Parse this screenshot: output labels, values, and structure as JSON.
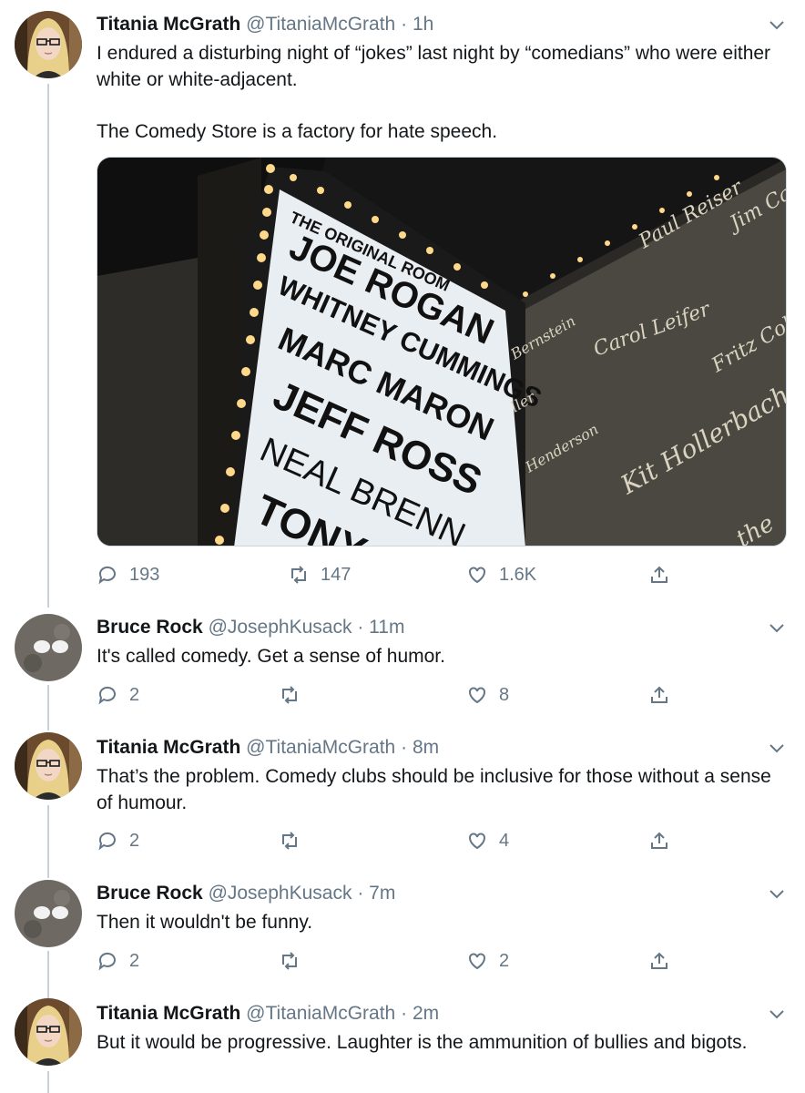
{
  "tweets": [
    {
      "name": "Titania McGrath",
      "handle": "@TitaniaMcGrath",
      "time": "1h",
      "text_1": "I endured a disturbing night of “jokes” last night by “comedians” who were either white or white-adjacent.",
      "text_2": "The Comedy Store is a factory for hate speech.",
      "replies": "193",
      "retweets": "147",
      "likes": "1.6K",
      "avatar_icon": "woman-portrait-avatar",
      "marquee": {
        "header": "THE ORIGINAL ROOM",
        "lines": [
          "JOE ROGAN",
          "WHITNEY CUMMINGS",
          "MARC MARON",
          "JEFF ROSS",
          "NEAL BRENN",
          "TONY"
        ],
        "wall_signatures": [
          "Paul Reiser",
          "Jim Ca",
          "Carol Leifer",
          "Fritz Col",
          "Kit Hollerbach",
          "the",
          "Bernstein",
          "Henderson",
          "ller"
        ]
      }
    },
    {
      "name": "Bruce Rock",
      "handle": "@JosephKusack",
      "time": "11m",
      "text_1": "It's called comedy. Get a sense of humor.",
      "replies": "2",
      "retweets": "",
      "likes": "8",
      "avatar_icon": "rock-skull-avatar"
    },
    {
      "name": "Titania McGrath",
      "handle": "@TitaniaMcGrath",
      "time": "8m",
      "text_1": "That’s the problem. Comedy clubs should be inclusive for those without a sense of humour.",
      "replies": "2",
      "retweets": "",
      "likes": "4",
      "avatar_icon": "woman-portrait-avatar"
    },
    {
      "name": "Bruce Rock",
      "handle": "@JosephKusack",
      "time": "7m",
      "text_1": "Then it wouldn't be funny.",
      "replies": "2",
      "retweets": "",
      "likes": "2",
      "avatar_icon": "rock-skull-avatar"
    },
    {
      "name": "Titania McGrath",
      "handle": "@TitaniaMcGrath",
      "time": "2m",
      "text_1": "But it would be progressive. Laughter is the ammunition of bullies and bigots.",
      "avatar_icon": "woman-portrait-avatar"
    }
  ],
  "separator": "·",
  "colors": {
    "text": "#14171a",
    "muted": "#657786",
    "line": "#c9d1d8"
  }
}
